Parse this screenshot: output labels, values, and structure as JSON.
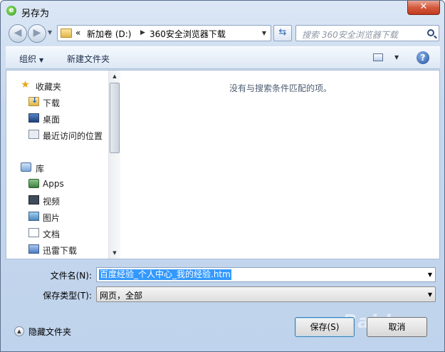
{
  "window": {
    "title": "另存为",
    "close_glyph": "✕"
  },
  "nav": {
    "back_glyph": "◀",
    "forward_glyph": "▶",
    "path_prefix": "«",
    "path": [
      "新加卷 (D:)",
      "360安全浏览器下载"
    ],
    "refresh_glyph": "⇆",
    "search_placeholder": "搜索 360安全浏览器下载"
  },
  "toolbar": {
    "organize": "组织",
    "new_folder": "新建文件夹",
    "help": "?"
  },
  "sidebar": {
    "favorites": {
      "label": "收藏夹",
      "items": [
        "下载",
        "桌面",
        "最近访问的位置"
      ]
    },
    "libraries": {
      "label": "库",
      "items": [
        "Apps",
        "视频",
        "图片",
        "文档",
        "迅雷下载"
      ]
    }
  },
  "content": {
    "empty_message": "没有与搜索条件匹配的项。"
  },
  "form": {
    "filename_label": "文件名(N):",
    "filename_value": "百度经验_个人中心_我的经验.htm",
    "filetype_label": "保存类型(T):",
    "filetype_value": "网页，全部"
  },
  "footer": {
    "hide_folders": "隐藏文件夹",
    "save": "保存(S)",
    "cancel": "取消"
  },
  "watermark": {
    "text": "Baidu"
  }
}
